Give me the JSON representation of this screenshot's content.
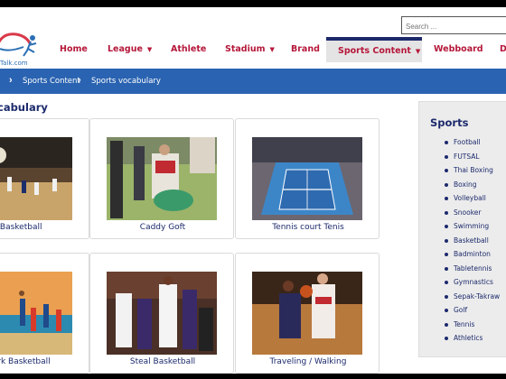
{
  "header": {
    "logo_text": "Talk.com",
    "search_placeholder": "Search ..."
  },
  "nav": {
    "items": [
      {
        "label": "Home"
      },
      {
        "label": "League",
        "caret": "▼"
      },
      {
        "label": "Athlete"
      },
      {
        "label": "Stadium",
        "caret": "▼"
      },
      {
        "label": "Brand"
      },
      {
        "label": "Sports Content",
        "caret": "▼",
        "active": true
      },
      {
        "label": "Webboard"
      },
      {
        "label": "D"
      }
    ]
  },
  "breadcrumb": {
    "items": [
      "Sports Content",
      "Sports vocabulary"
    ]
  },
  "main": {
    "title": "cabulary",
    "cards": [
      {
        "label": "t Basketball"
      },
      {
        "label": "Caddy Goft"
      },
      {
        "label": "Tennis court Tenis"
      },
      {
        "label": "work Basketball"
      },
      {
        "label": "Steal Basketball"
      },
      {
        "label": "Traveling / Walking"
      }
    ]
  },
  "sidebar": {
    "title": "Sports",
    "items": [
      "Football",
      "FUTSAL",
      "Thai Boxing",
      "Boxing",
      "Volleyball",
      "Snooker",
      "Swimming",
      "Basketball",
      "Badminton",
      "Tabletennis",
      "Gymnastics",
      "Sepak-Takraw",
      "Golf",
      "Tennis",
      "Athletics"
    ]
  },
  "colors": {
    "nav_text": "#b5173a",
    "nav_active_bg": "#e4e4e4",
    "breadcrumb_bg": "#2a63b1",
    "link_text": "#1c2a6c"
  }
}
